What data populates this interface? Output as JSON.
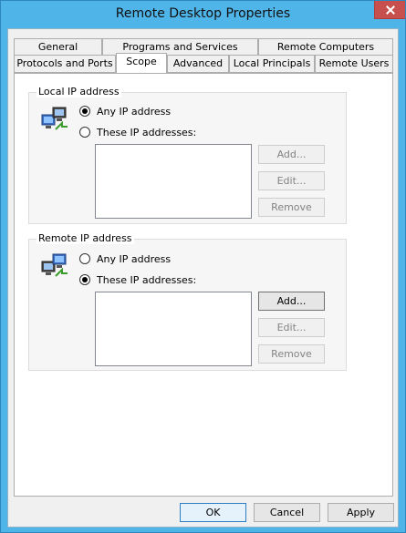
{
  "window": {
    "title": "Remote Desktop Properties"
  },
  "tabs": {
    "row1": [
      {
        "label": "General"
      },
      {
        "label": "Programs and Services"
      },
      {
        "label": "Remote Computers"
      }
    ],
    "row2": [
      {
        "label": "Protocols and Ports"
      },
      {
        "label": "Scope",
        "selected": true
      },
      {
        "label": "Advanced"
      },
      {
        "label": "Local Principals"
      },
      {
        "label": "Remote Users"
      }
    ]
  },
  "local_ip": {
    "group_title": "Local IP address",
    "option_any": "Any IP address",
    "option_these": "These IP addresses:",
    "selected": "any",
    "addresses": [],
    "buttons": {
      "add": "Add...",
      "edit": "Edit...",
      "remove": "Remove"
    }
  },
  "remote_ip": {
    "group_title": "Remote IP address",
    "option_any": "Any IP address",
    "option_these": "These IP addresses:",
    "selected": "these",
    "addresses": [],
    "buttons": {
      "add": "Add...",
      "edit": "Edit...",
      "remove": "Remove"
    }
  },
  "footer": {
    "ok": "OK",
    "cancel": "Cancel",
    "apply": "Apply"
  },
  "colors": {
    "frame": "#4fb4e8",
    "close": "#c7504e",
    "focus": "#2e7ec5"
  }
}
